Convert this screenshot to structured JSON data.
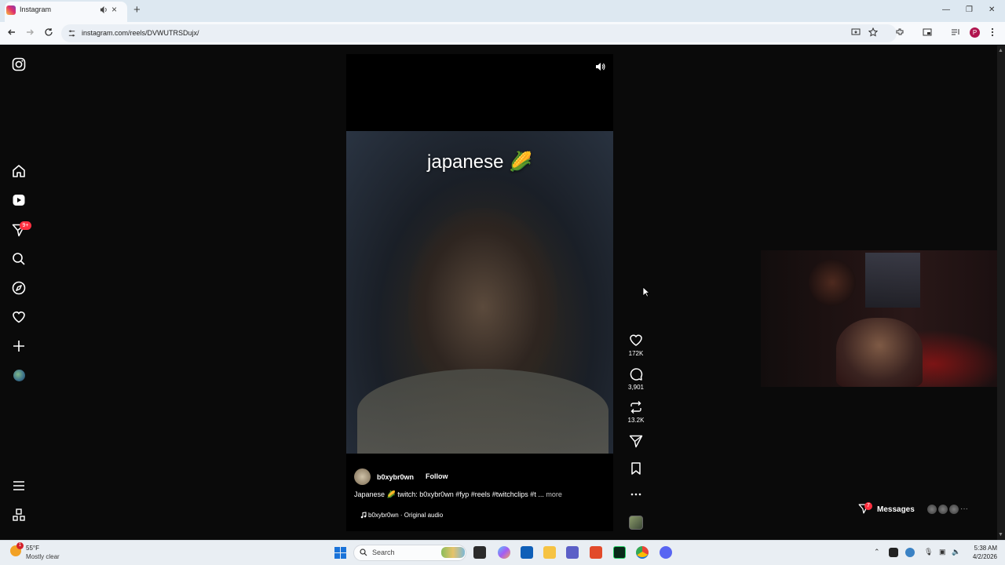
{
  "browser": {
    "tab_title": "Instagram",
    "url": "instagram.com/reels/DVWUTRSDujx/",
    "profile_initial": "P",
    "new_tab_label": "+",
    "close_tab_label": "×"
  },
  "sidebar": {
    "notifications_badge": "9+"
  },
  "reel": {
    "overlay_caption": "japanese 🌽",
    "author": "b0xybr0wn",
    "follow_label": "Follow",
    "description": "Japanese 🌽 twitch: b0xybr0wn #fyp #reels #twitchclips #t ...",
    "more_label": " more",
    "audio": "b0xybr0wn · Original audio",
    "likes": "172K",
    "comments": "3,901",
    "reposts": "13.2K"
  },
  "messages": {
    "label": "Messages",
    "badge": "7",
    "more": "···"
  },
  "taskbar": {
    "weather_temp": "55°F",
    "weather_desc": "Mostly clear",
    "weather_badge": "1",
    "search_label": "Search",
    "time": "5:38 AM",
    "date": "4/2/2026"
  },
  "colors": {
    "accent_badge": "#ff3040",
    "ig_background": "#0a0a0a"
  }
}
